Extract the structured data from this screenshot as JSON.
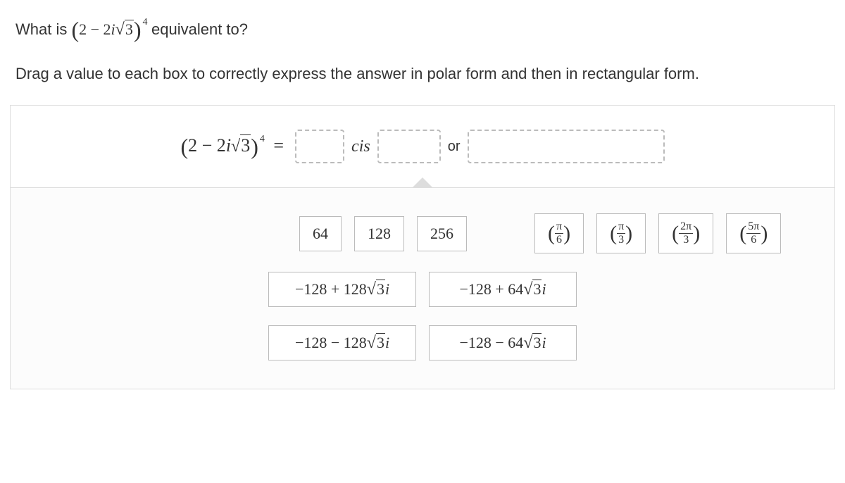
{
  "question": {
    "prefix": "What is ",
    "expr_open": "(",
    "expr_body_a": "2 − 2",
    "expr_i": "i",
    "expr_sqrt": "3",
    "expr_close": ")",
    "expr_exp": "4",
    "suffix": " equivalent to?"
  },
  "instruction": "Drag a value to each box to correctly express the answer in polar form and then in rectangular form.",
  "equation": {
    "lhs_open": "(",
    "lhs_body_a": "2 − 2",
    "lhs_i": "i",
    "lhs_sqrt": "3",
    "lhs_close": ")",
    "lhs_exp": "4",
    "eq": "=",
    "cis": "cis",
    "or": "or"
  },
  "tiles": {
    "n64": "64",
    "n128": "128",
    "n256": "256",
    "pi6_num": "π",
    "pi6_den": "6",
    "pi3_num": "π",
    "pi3_den": "3",
    "t2pi3_num": "2π",
    "t2pi3_den": "3",
    "t5pi6_num": "5π",
    "t5pi6_den": "6",
    "r1_a": "−128 + 128",
    "r1_sqrt": "3",
    "r1_i": "i",
    "r2_a": "−128 + 64",
    "r2_sqrt": "3",
    "r2_i": "i",
    "r3_a": "−128 − 128",
    "r3_sqrt": "3",
    "r3_i": "i",
    "r4_a": "−128 − 64",
    "r4_sqrt": "3",
    "r4_i": "i"
  }
}
